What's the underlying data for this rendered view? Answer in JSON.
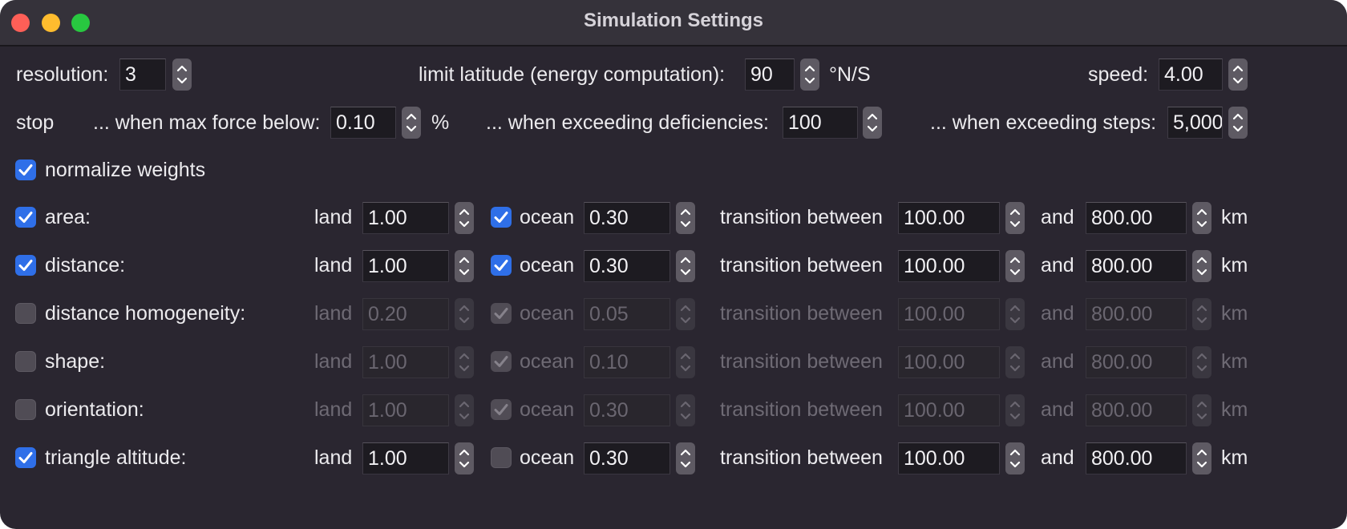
{
  "window": {
    "title": "Simulation Settings",
    "colors": {
      "close": "#fe5f57",
      "minimize": "#febc2e",
      "zoom": "#28c840",
      "accent": "#2f6fe8"
    }
  },
  "general": {
    "resolution_label": "resolution:",
    "resolution_value": "3",
    "limit_latitude_label": "limit latitude (energy computation):",
    "limit_latitude_value": "90",
    "limit_latitude_unit": "°N/S",
    "speed_label": "speed:",
    "speed_value": "4.00"
  },
  "stop": {
    "label": "stop",
    "max_force_label": "... when max force below:",
    "max_force_value": "0.10",
    "max_force_unit": "%",
    "deficiencies_label": "... when exceeding deficiencies:",
    "deficiencies_value": "100",
    "steps_label": "... when exceeding steps:",
    "steps_value": "5,000"
  },
  "normalize": {
    "label": "normalize weights",
    "checked": true
  },
  "weights": {
    "land_label": "land",
    "ocean_label": "ocean",
    "transition_label": "transition between",
    "and_label": "and",
    "unit": "km",
    "rows": [
      {
        "name": "area:",
        "enabled": true,
        "land": "1.00",
        "ocean_checked": true,
        "ocean": "0.30",
        "from": "100.00",
        "to": "800.00"
      },
      {
        "name": "distance:",
        "enabled": true,
        "land": "1.00",
        "ocean_checked": true,
        "ocean": "0.30",
        "from": "100.00",
        "to": "800.00"
      },
      {
        "name": "distance homogeneity:",
        "enabled": false,
        "land": "0.20",
        "ocean_checked": true,
        "ocean": "0.05",
        "from": "100.00",
        "to": "800.00"
      },
      {
        "name": "shape:",
        "enabled": false,
        "land": "1.00",
        "ocean_checked": true,
        "ocean": "0.10",
        "from": "100.00",
        "to": "800.00"
      },
      {
        "name": "orientation:",
        "enabled": false,
        "land": "1.00",
        "ocean_checked": true,
        "ocean": "0.30",
        "from": "100.00",
        "to": "800.00"
      },
      {
        "name": "triangle altitude:",
        "enabled": true,
        "land": "1.00",
        "ocean_checked": false,
        "ocean": "0.30",
        "from": "100.00",
        "to": "800.00"
      }
    ]
  }
}
